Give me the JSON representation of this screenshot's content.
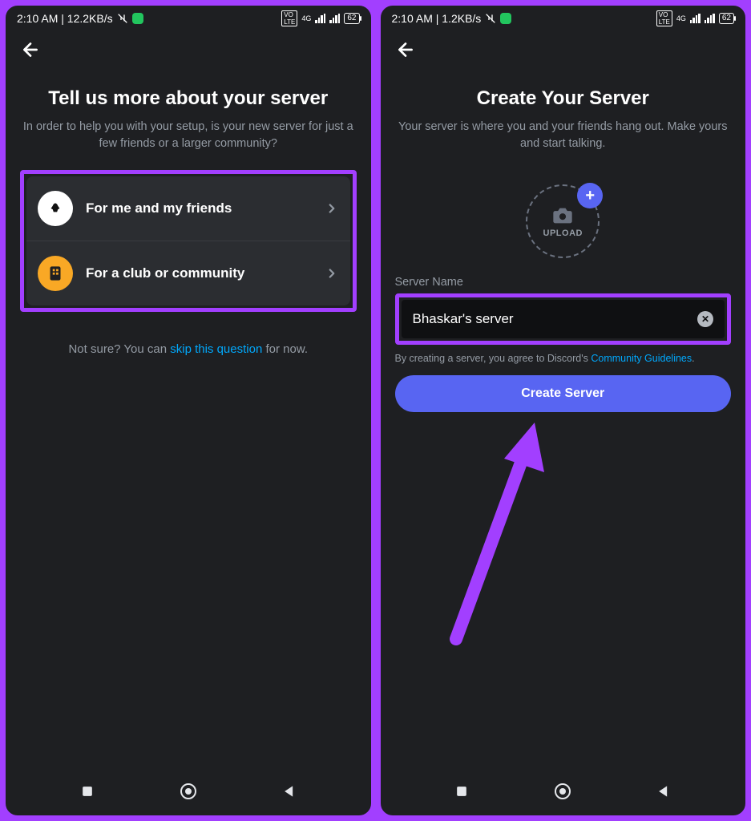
{
  "left": {
    "status": {
      "time_net": "2:10 AM | 12.2KB/s",
      "battery": "62"
    },
    "title": "Tell us more about your server",
    "subtitle": "In order to help you with your setup, is your new server for just a few friends or a larger community?",
    "options": [
      {
        "label": "For me and my friends"
      },
      {
        "label": "For a club or community"
      }
    ],
    "not_sure_pre": "Not sure? You can ",
    "not_sure_link": "skip this question",
    "not_sure_post": " for now."
  },
  "right": {
    "status": {
      "time_net": "2:10 AM | 1.2KB/s",
      "battery": "62"
    },
    "title": "Create Your Server",
    "subtitle": "Your server is where you and your friends hang out. Make yours and start talking.",
    "upload_label": "UPLOAD",
    "field_label": "Server Name",
    "server_name": "Bhaskar's server",
    "agree_pre": "By creating a server, you agree to Discord's ",
    "agree_link": "Community Guidelines",
    "agree_post": ".",
    "create_label": "Create Server"
  }
}
